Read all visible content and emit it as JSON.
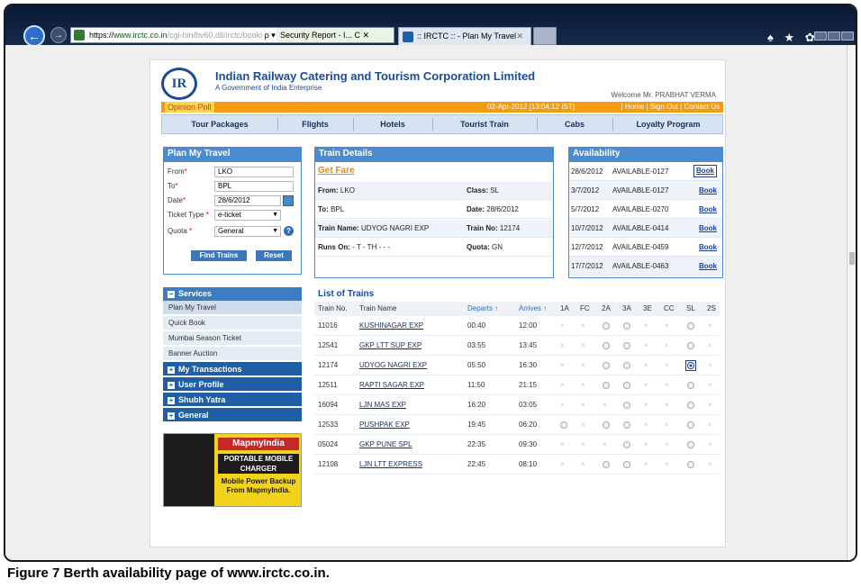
{
  "browser": {
    "url_prefix": "https://",
    "url_host": "www.irctc.co.in",
    "url_path": "/cgi-bin/bv60.dll/irctc/booki",
    "address_icons": "ρ ▾",
    "security_label": "Security Report - I... C ✕",
    "tab_label": ":: IRCTC :: - Plan My Travel",
    "tab_close": "✕",
    "toolbar_icons": "♠ ★ ✿"
  },
  "site": {
    "logo": "IR",
    "org_name": "Indian Railway Catering and Tourism Corporation Limited",
    "org_sub": "A Government of India Enterprise",
    "welcome": "Welcome Mr. PRABHAT VERMA",
    "opinion_poll": "Opinion Poll",
    "datetime": "02-Apr-2012 [13:04:12 IST]",
    "top_links": "| Home | Sign Out | Contact Us"
  },
  "nav": [
    "Tour Packages",
    "Flights",
    "Hotels",
    "Tourist Train",
    "Cabs",
    "Loyalty Program"
  ],
  "plan": {
    "title": "Plan My Travel",
    "from_label": "From",
    "from_value": "LKO",
    "to_label": "To",
    "to_value": "BPL",
    "date_label": "Date",
    "date_value": "28/6/2012",
    "ticket_type_label": "Ticket Type",
    "ticket_type_value": "e-ticket",
    "quota_label": "Quota",
    "quota_value": "General",
    "required_mark": "*",
    "select_arrow": "▼",
    "help_icon": "?",
    "find_button": "Find Trains",
    "reset_button": "Reset"
  },
  "train_details": {
    "title": "Train Details",
    "get_fare": "Get Fare",
    "from_label": "From:",
    "from_value": "LKO",
    "class_label": "Class:",
    "class_value": "SL",
    "to_label": "To:",
    "to_value": "BPL",
    "date_label": "Date:",
    "date_value": "28/6/2012",
    "train_name_label": "Train Name:",
    "train_name_value": "UDYOG NAGRI EXP",
    "train_no_label": "Train No:",
    "train_no_value": "12174",
    "runs_on_label": "Runs On:",
    "runs_on_value": "- T - TH - - -",
    "quota_label": "Quota:",
    "quota_value": "GN"
  },
  "availability": {
    "title": "Availability",
    "book_label": "Book",
    "rows": [
      {
        "date": "28/6/2012",
        "status": "AVAILABLE-0127"
      },
      {
        "date": "3/7/2012",
        "status": "AVAILABLE-0127"
      },
      {
        "date": "5/7/2012",
        "status": "AVAILABLE-0270"
      },
      {
        "date": "10/7/2012",
        "status": "AVAILABLE-0414"
      },
      {
        "date": "12/7/2012",
        "status": "AVAILABLE-0459"
      },
      {
        "date": "17/7/2012",
        "status": "AVAILABLE-0463"
      }
    ]
  },
  "menu": {
    "services": "Services",
    "services_items": [
      "Plan My Travel",
      "Quick Book",
      "Mumbai Season Ticket",
      "Banner Auction"
    ],
    "groups": [
      "My Transactions",
      "User Profile",
      "Shubh Yatra",
      "General"
    ],
    "plus": "+",
    "minus": "−"
  },
  "ad": {
    "brand": "MapmyIndia",
    "line1": "PORTABLE MOBILE CHARGER",
    "line2": "Mobile Power Backup From MapmyIndia."
  },
  "trains": {
    "title": "List of Trains",
    "headers": {
      "train_no": "Train No.",
      "train_name": "Train Name",
      "departs": "Departs ↑",
      "arrives": "Arrives ↑",
      "classes": [
        "1A",
        "FC",
        "2A",
        "3A",
        "3E",
        "CC",
        "SL",
        "2S"
      ]
    },
    "unavailable_mark": "×",
    "rows": [
      {
        "no": "11016",
        "name": "KUSHINAGAR EXP",
        "dep": "00:40",
        "arr": "12:00",
        "cls": [
          0,
          0,
          1,
          1,
          0,
          0,
          1,
          0
        ]
      },
      {
        "no": "12541",
        "name": "GKP LTT SUP EXP",
        "dep": "03:55",
        "arr": "13:45",
        "cls": [
          0,
          0,
          1,
          1,
          0,
          0,
          1,
          0
        ]
      },
      {
        "no": "12174",
        "name": "UDYOG NAGRI EXP",
        "dep": "05:50",
        "arr": "16:30",
        "cls": [
          0,
          0,
          1,
          1,
          0,
          0,
          2,
          0
        ]
      },
      {
        "no": "12511",
        "name": "RAPTI SAGAR EXP",
        "dep": "11:50",
        "arr": "21:15",
        "cls": [
          0,
          0,
          1,
          1,
          0,
          0,
          1,
          0
        ]
      },
      {
        "no": "16094",
        "name": "LJN MAS EXP",
        "dep": "16:20",
        "arr": "03:05",
        "cls": [
          0,
          0,
          0,
          1,
          0,
          0,
          1,
          0
        ]
      },
      {
        "no": "12533",
        "name": "PUSHPAK EXP",
        "dep": "19:45",
        "arr": "06:20",
        "cls": [
          1,
          0,
          1,
          1,
          0,
          0,
          1,
          0
        ]
      },
      {
        "no": "05024",
        "name": "GKP PUNE SPL",
        "dep": "22:35",
        "arr": "09:30",
        "cls": [
          0,
          0,
          0,
          1,
          0,
          0,
          1,
          0
        ]
      },
      {
        "no": "12108",
        "name": "LJN LTT EXPRESS",
        "dep": "22:45",
        "arr": "08:10",
        "cls": [
          0,
          0,
          1,
          1,
          0,
          0,
          1,
          0
        ]
      }
    ]
  },
  "caption": {
    "bold": "Figure 7 Berth availability page of www.irctc.co.in."
  }
}
